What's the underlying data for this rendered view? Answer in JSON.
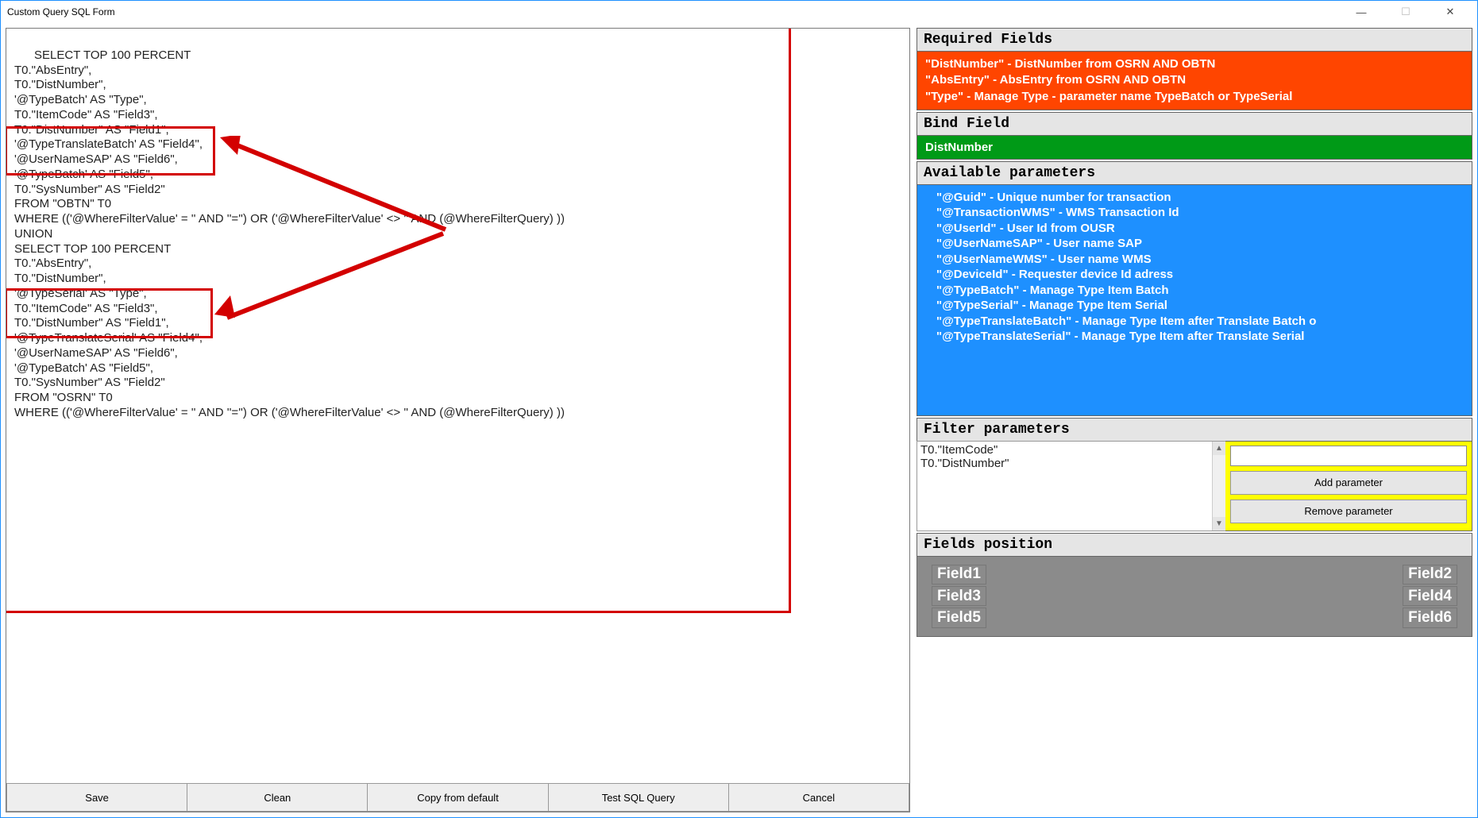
{
  "window": {
    "title": "Custom Query SQL Form"
  },
  "sql_text": "SELECT TOP 100 PERCENT\nT0.\"AbsEntry\",\nT0.\"DistNumber\",\n'@TypeBatch' AS \"Type\",\nT0.\"ItemCode\" AS \"Field3\",\nT0.\"DistNumber\" AS \"Field1\",\n'@TypeTranslateBatch' AS \"Field4\",\n'@UserNameSAP' AS \"Field6\",\n'@TypeBatch' AS \"Field5\",\nT0.\"SysNumber\" AS \"Field2\"\nFROM \"OBTN\" T0\nWHERE (('@WhereFilterValue' = '' AND ''='') OR ('@WhereFilterValue' <> '' AND (@WhereFilterQuery) ))\nUNION\nSELECT TOP 100 PERCENT\nT0.\"AbsEntry\",\nT0.\"DistNumber\",\n'@TypeSerial' AS \"Type\",\nT0.\"ItemCode\" AS \"Field3\",\nT0.\"DistNumber\" AS \"Field1\",\n'@TypeTranslateSerial' AS \"Field4\",\n'@UserNameSAP' AS \"Field6\",\n'@TypeBatch' AS \"Field5\",\nT0.\"SysNumber\" AS \"Field2\"\nFROM \"OSRN\" T0\nWHERE (('@WhereFilterValue' = '' AND ''='') OR ('@WhereFilterValue' <> '' AND (@WhereFilterQuery) ))",
  "buttons": {
    "save": "Save",
    "clean": "Clean",
    "copy": "Copy from default",
    "test": "Test SQL Query",
    "cancel": "Cancel"
  },
  "required": {
    "header": "Required Fields",
    "line1": "\"DistNumber\" - DistNumber from OSRN AND OBTN",
    "line2": "\"AbsEntry\" - AbsEntry from OSRN AND OBTN",
    "line3": "\"Type\" - Manage Type - parameter name TypeBatch or TypeSerial"
  },
  "bind": {
    "header": "Bind Field",
    "value": "DistNumber"
  },
  "available": {
    "header": "Available parameters",
    "items": [
      "\"@Guid\" - Unique number for transaction",
      "\"@TransactionWMS\" - WMS Transaction Id",
      "\"@UserId\" - User Id from OUSR",
      "\"@UserNameSAP\" - User name SAP",
      "\"@UserNameWMS\" - User name WMS",
      "\"@DeviceId\" - Requester device Id adress",
      "\"@TypeBatch\" - Manage Type Item Batch",
      "\"@TypeSerial\" - Manage Type Item Serial",
      "\"@TypeTranslateBatch\" - Manage Type Item after Translate Batch o",
      "\"@TypeTranslateSerial\" - Manage Type Item after Translate Serial"
    ]
  },
  "filter": {
    "header": "Filter parameters",
    "textarea_value": "T0.\"ItemCode\"\nT0.\"DistNumber\"",
    "input_value": "",
    "add": "Add parameter",
    "remove": "Remove parameter"
  },
  "fields_position": {
    "header": "Fields position",
    "left": [
      "Field1",
      "Field3",
      "Field5"
    ],
    "right": [
      "Field2",
      "Field4",
      "Field6"
    ]
  }
}
